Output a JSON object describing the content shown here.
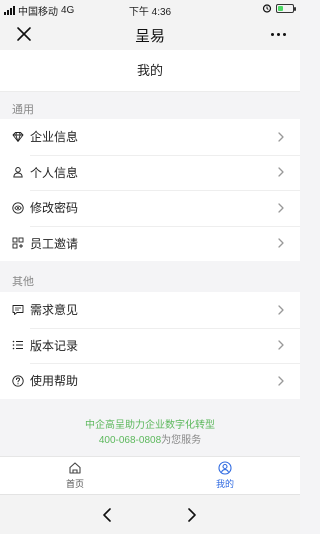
{
  "status_bar": {
    "carrier": "中国移动",
    "network": "4G",
    "time": "下午 4:36",
    "battery_level": 0.35
  },
  "nav": {
    "title": "呈易",
    "close_icon": "close-icon",
    "more_icon": "more-icon"
  },
  "page": {
    "title": "我的"
  },
  "sections": [
    {
      "label": "通用",
      "items": [
        {
          "label": "企业信息",
          "icon": "diamond-icon"
        },
        {
          "label": "个人信息",
          "icon": "person-icon"
        },
        {
          "label": "修改密码",
          "icon": "eye-icon"
        },
        {
          "label": "员工邀请",
          "icon": "grid-icon"
        }
      ]
    },
    {
      "label": "其他",
      "items": [
        {
          "label": "需求意见",
          "icon": "message-icon"
        },
        {
          "label": "版本记录",
          "icon": "list-icon"
        },
        {
          "label": "使用帮助",
          "icon": "help-icon"
        }
      ]
    }
  ],
  "footer": {
    "slogan": "中企高呈助力企业数字化转型",
    "phone": "400-068-0808",
    "phone_suffix": "为您服务"
  },
  "tabbar": {
    "tabs": [
      {
        "label": "首页",
        "icon": "home-icon",
        "active": false
      },
      {
        "label": "我的",
        "icon": "user-icon",
        "active": true
      }
    ]
  },
  "colors": {
    "accent": "#2f6ae1",
    "footer_green": "#5cb85c"
  }
}
